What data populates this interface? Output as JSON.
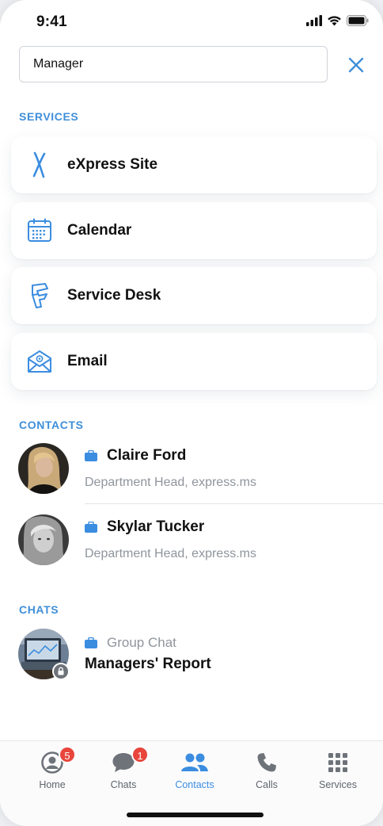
{
  "status_bar": {
    "time": "9:41"
  },
  "search": {
    "value": "Manager"
  },
  "sections": {
    "services": "SERVICES",
    "contacts": "CONTACTS",
    "chats": "CHATS"
  },
  "services": [
    {
      "label": "eXpress Site",
      "icon": "express-logo-icon"
    },
    {
      "label": "Calendar",
      "icon": "calendar-icon"
    },
    {
      "label": "Service Desk",
      "icon": "service-desk-icon"
    },
    {
      "label": "Email",
      "icon": "email-icon"
    }
  ],
  "contacts": [
    {
      "name": "Claire Ford",
      "subtitle": "Department Head, express.ms"
    },
    {
      "name": "Skylar Tucker",
      "subtitle": "Department Head, express.ms"
    }
  ],
  "chats": [
    {
      "type_label": "Group Chat",
      "name": "Managers' Report"
    }
  ],
  "tabbar": [
    {
      "label": "Home",
      "badge": "5",
      "icon": "profile-icon"
    },
    {
      "label": "Chats",
      "badge": "1",
      "icon": "chat-bubble-icon"
    },
    {
      "label": "Contacts",
      "badge": "",
      "icon": "contacts-icon",
      "active": true
    },
    {
      "label": "Calls",
      "badge": "",
      "icon": "phone-icon"
    },
    {
      "label": "Services",
      "badge": "",
      "icon": "grid-icon"
    }
  ],
  "colors": {
    "accent": "#3f8fd9",
    "badge": "#e8453c",
    "work_icon": "#3b8de0"
  }
}
